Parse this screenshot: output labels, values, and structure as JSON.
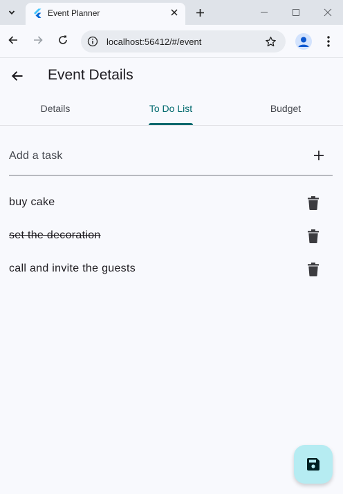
{
  "browser": {
    "tab_title": "Event Planner",
    "url": "localhost:56412/#/event",
    "icons": [
      "tab-search-icon",
      "flutter-icon",
      "close-icon",
      "plus-icon",
      "minimize-icon",
      "maximize-icon",
      "window-close-icon",
      "back-icon",
      "forward-icon",
      "reload-icon",
      "site-info-icon",
      "star-icon",
      "profile-icon",
      "menu-icon"
    ]
  },
  "app": {
    "title": "Event Details",
    "tabs": [
      {
        "label": "Details",
        "active": false
      },
      {
        "label": "To Do List",
        "active": true
      },
      {
        "label": "Budget",
        "active": false
      }
    ],
    "task_input": {
      "placeholder": "Add a task",
      "value": ""
    },
    "tasks": [
      {
        "text": "buy cake",
        "done": false
      },
      {
        "text": "set the decoration",
        "done": true
      },
      {
        "text": "call and invite the guests",
        "done": false
      }
    ],
    "fab_icon": "save-icon"
  },
  "colors": {
    "accent": "#00696e",
    "fab_background": "#b6ecf2",
    "background": "#f8f9fd"
  }
}
